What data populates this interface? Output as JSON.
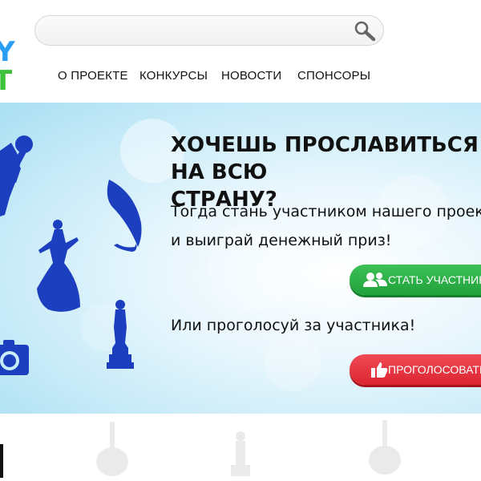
{
  "header": {
    "logo": {
      "line1": "Y",
      "line2": "T"
    },
    "search": {
      "value": "",
      "placeholder": ""
    },
    "nav": [
      {
        "label": "О ПРОЕКТЕ"
      },
      {
        "label": "КОНКУРСЫ"
      },
      {
        "label": "НОВОСТИ"
      },
      {
        "label": "СПОНСОРЫ"
      }
    ]
  },
  "hero": {
    "title": "ХОЧЕШЬ ПРОСЛАВИТЬСЯ НА ВСЮ\nСТРАНУ?",
    "text": "Тогда стань участником нашего проекта и выиграй денежный приз!",
    "join_button": {
      "label": "СТАТЬ УЧАСТНИКОМ",
      "icon": "users-icon"
    },
    "vote_text": "Или проголосуй за участника!",
    "vote_button": {
      "label": "ПРОГОЛОСОВАТЬ",
      "icon": "thumbs-up-icon"
    },
    "art_icons": [
      "microphone-icon",
      "quill-icon",
      "dancer-icon",
      "trophy-icon",
      "camera-icon"
    ]
  },
  "colors": {
    "join": "#2db249",
    "vote": "#e6313d",
    "hero_icons": "#1b3fbf",
    "logo_blue": "#2a9df4",
    "logo_green": "#3cc13b"
  }
}
